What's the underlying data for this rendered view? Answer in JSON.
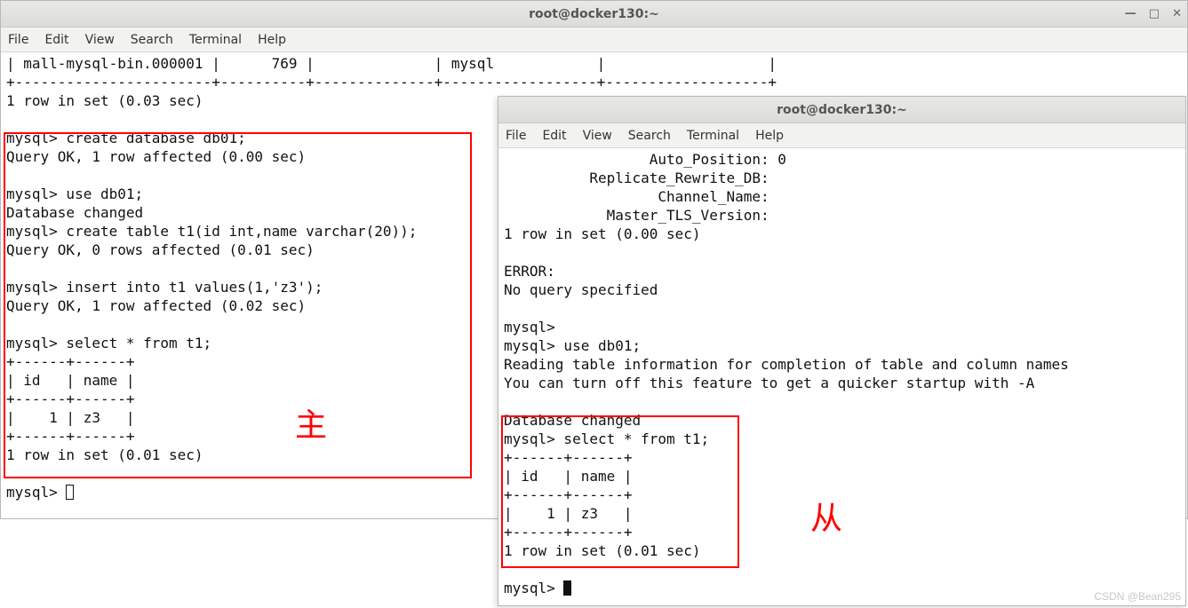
{
  "win1": {
    "title": "root@docker130:~",
    "menu": {
      "file": "File",
      "edit": "Edit",
      "view": "View",
      "search": "Search",
      "terminal": "Terminal",
      "help": "Help"
    },
    "l01": "| mall-mysql-bin.000001 |      769 |              | mysql            |                   |",
    "l02": "+-----------------------+----------+--------------+------------------+-------------------+",
    "l03": "1 row in set (0.03 sec)",
    "l04": "",
    "l05": "mysql> create database db01;",
    "l06": "Query OK, 1 row affected (0.00 sec)",
    "l07": "",
    "l08": "mysql> use db01;",
    "l09": "Database changed",
    "l10": "mysql> create table t1(id int,name varchar(20));",
    "l11": "Query OK, 0 rows affected (0.01 sec)",
    "l12": "",
    "l13": "mysql> insert into t1 values(1,'z3');",
    "l14": "Query OK, 1 row affected (0.02 sec)",
    "l15": "",
    "l16": "mysql> select * from t1;",
    "l17": "+------+------+",
    "l18": "| id   | name |",
    "l19": "+------+------+",
    "l20": "|    1 | z3   |",
    "l21": "+------+------+",
    "l22": "1 row in set (0.01 sec)",
    "l23": "",
    "l24": "mysql> "
  },
  "win2": {
    "title": "root@docker130:~",
    "menu": {
      "file": "File",
      "edit": "Edit",
      "view": "View",
      "search": "Search",
      "terminal": "Terminal",
      "help": "Help"
    },
    "l01": "                 Auto_Position: 0",
    "l02": "          Replicate_Rewrite_DB:",
    "l03": "                  Channel_Name:",
    "l04": "            Master_TLS_Version:",
    "l05": "1 row in set (0.00 sec)",
    "l06": "",
    "l07": "ERROR:",
    "l08": "No query specified",
    "l09": "",
    "l10": "mysql>",
    "l11": "mysql> use db01;",
    "l12": "Reading table information for completion of table and column names",
    "l13": "You can turn off this feature to get a quicker startup with -A",
    "l14": "",
    "l15": "Database changed",
    "l16": "mysql> select * from t1;",
    "l17": "+------+------+",
    "l18": "| id   | name |",
    "l19": "+------+------+",
    "l20": "|    1 | z3   |",
    "l21": "+------+------+",
    "l22": "1 row in set (0.01 sec)",
    "l23": "",
    "l24": "mysql> "
  },
  "anno": {
    "master": "主",
    "slave": "从"
  },
  "watermark": "CSDN @Bean295"
}
